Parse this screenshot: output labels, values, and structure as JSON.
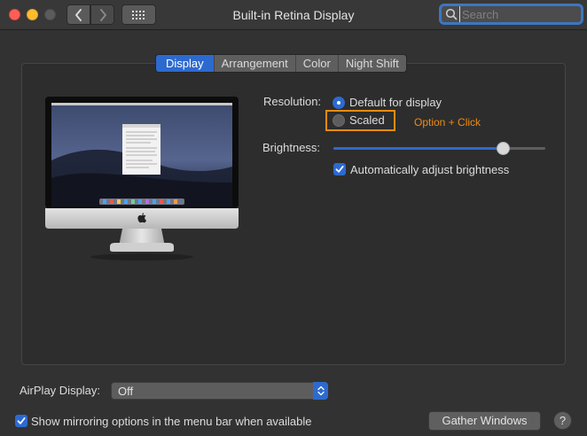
{
  "window": {
    "title": "Built-in Retina Display",
    "search_placeholder": "Search"
  },
  "tabs": [
    {
      "label": "Display",
      "active": true
    },
    {
      "label": "Arrangement",
      "active": false
    },
    {
      "label": "Color",
      "active": false
    },
    {
      "label": "Night Shift",
      "active": false
    }
  ],
  "display": {
    "resolution_label": "Resolution:",
    "resolution_options": [
      {
        "label": "Default for display",
        "selected": true
      },
      {
        "label": "Scaled",
        "selected": false
      }
    ],
    "hint": "Option + Click",
    "brightness_label": "Brightness:",
    "brightness_value": 0.8,
    "auto_brightness_label": "Automatically adjust brightness",
    "auto_brightness_checked": true
  },
  "airplay": {
    "label": "AirPlay Display:",
    "value": "Off"
  },
  "mirroring": {
    "label": "Show mirroring options in the menu bar when available",
    "checked": true
  },
  "buttons": {
    "gather_windows": "Gather Windows",
    "help": "?"
  },
  "colors": {
    "accent": "#2d6ad0",
    "highlight": "#f08a0f"
  }
}
